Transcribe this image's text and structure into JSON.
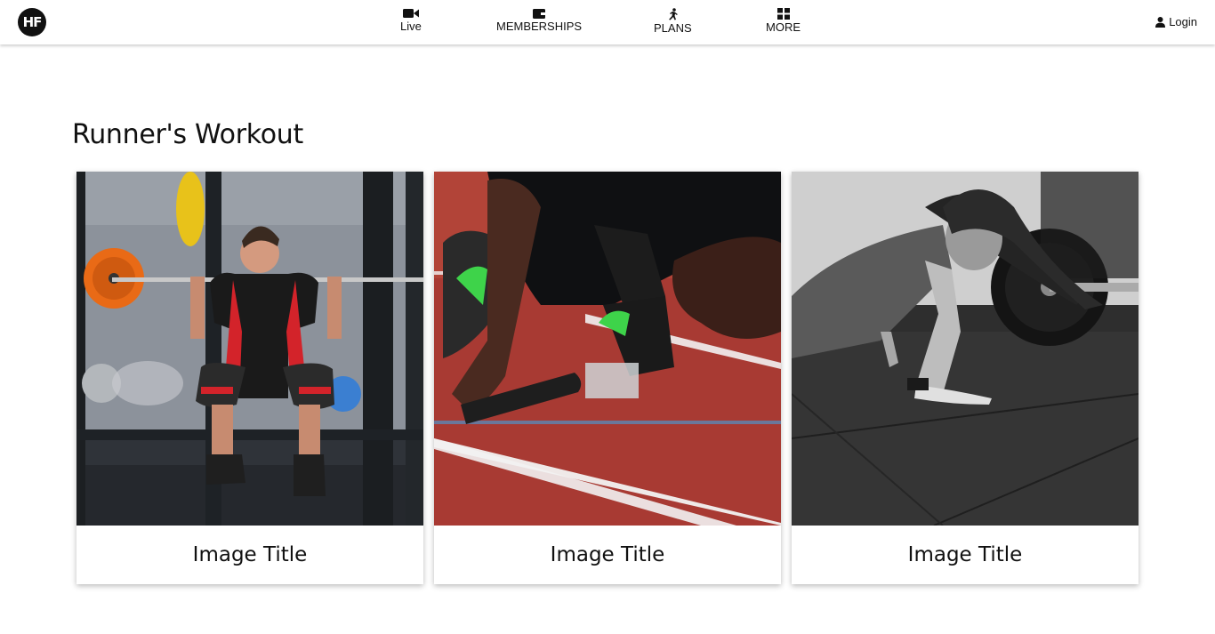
{
  "header": {
    "logo_text": "HF",
    "nav": [
      {
        "label": "Live",
        "icon": "video-camera-icon"
      },
      {
        "label": "MEMBERSHIPS",
        "icon": "wallet-icon"
      },
      {
        "label": "PLANS",
        "icon": "running-person-icon"
      },
      {
        "label": "MORE",
        "icon": "grid-icon"
      }
    ],
    "login_label": "Login",
    "login_icon": "user-icon"
  },
  "main": {
    "title": "Runner's Workout",
    "cards": [
      {
        "caption": "Image Title",
        "image": "weightlifter-squat-photo"
      },
      {
        "caption": "Image Title",
        "image": "sprinter-track-start-photo"
      },
      {
        "caption": "Image Title",
        "image": "woman-pushup-gym-photo"
      }
    ]
  },
  "colors": {
    "text": "#111111",
    "background": "#ffffff",
    "track_red": "#a83a33",
    "gym_wall": "#8a9099"
  }
}
